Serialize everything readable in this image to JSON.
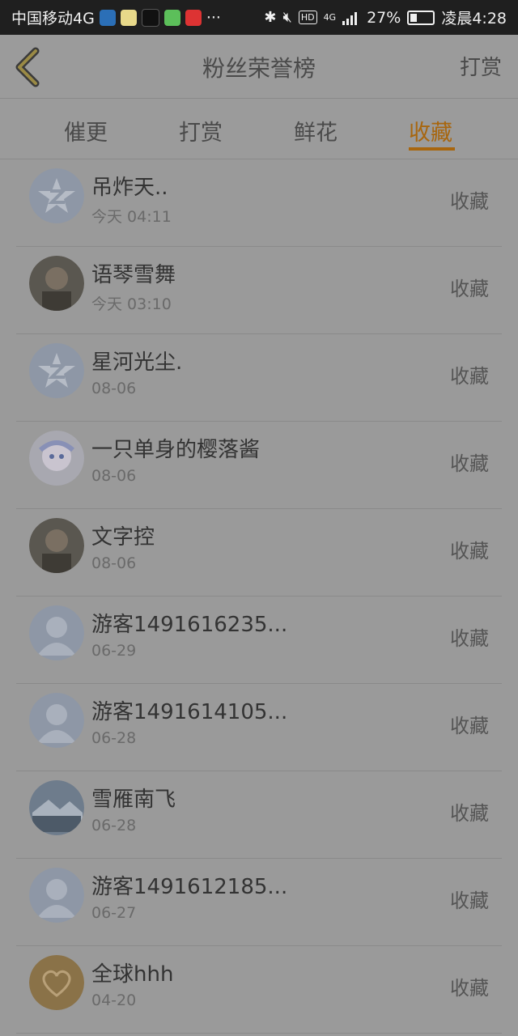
{
  "status_bar": {
    "carrier": "中国移动4G",
    "more": "···",
    "battery": "27%",
    "time": "凌晨4:28",
    "network": "4G",
    "hd": "HD"
  },
  "header": {
    "title": "粉丝荣誉榜",
    "right_button": "打赏"
  },
  "tabs": [
    {
      "label": "催更",
      "active": false
    },
    {
      "label": "打赏",
      "active": false
    },
    {
      "label": "鲜花",
      "active": false
    },
    {
      "label": "收藏",
      "active": true
    }
  ],
  "colors": {
    "accent": "#a8660e",
    "background": "#9a9a9a",
    "statusbar": "#1f1f1f"
  },
  "fans": [
    {
      "name": "吊炸天..",
      "time": "今天 04:11",
      "action": "收藏",
      "avatar": "qq-star"
    },
    {
      "name": "语琴雪舞",
      "time": "今天 03:10",
      "action": "收藏",
      "avatar": "photo"
    },
    {
      "name": "星河光尘.",
      "time": "08-06",
      "action": "收藏",
      "avatar": "qq-star"
    },
    {
      "name": "一只单身的樱落酱",
      "time": "08-06",
      "action": "收藏",
      "avatar": "anime"
    },
    {
      "name": "文字控",
      "time": "08-06",
      "action": "收藏",
      "avatar": "photo"
    },
    {
      "name": "游客1491616235...",
      "time": "06-29",
      "action": "收藏",
      "avatar": "default-user"
    },
    {
      "name": "游客1491614105...",
      "time": "06-28",
      "action": "收藏",
      "avatar": "default-user"
    },
    {
      "name": "雪雁南飞",
      "time": "06-28",
      "action": "收藏",
      "avatar": "landscape"
    },
    {
      "name": "游客1491612185...",
      "time": "06-27",
      "action": "收藏",
      "avatar": "default-user"
    },
    {
      "name": "全球hhh",
      "time": "04-20",
      "action": "收藏",
      "avatar": "heart-sand"
    }
  ]
}
